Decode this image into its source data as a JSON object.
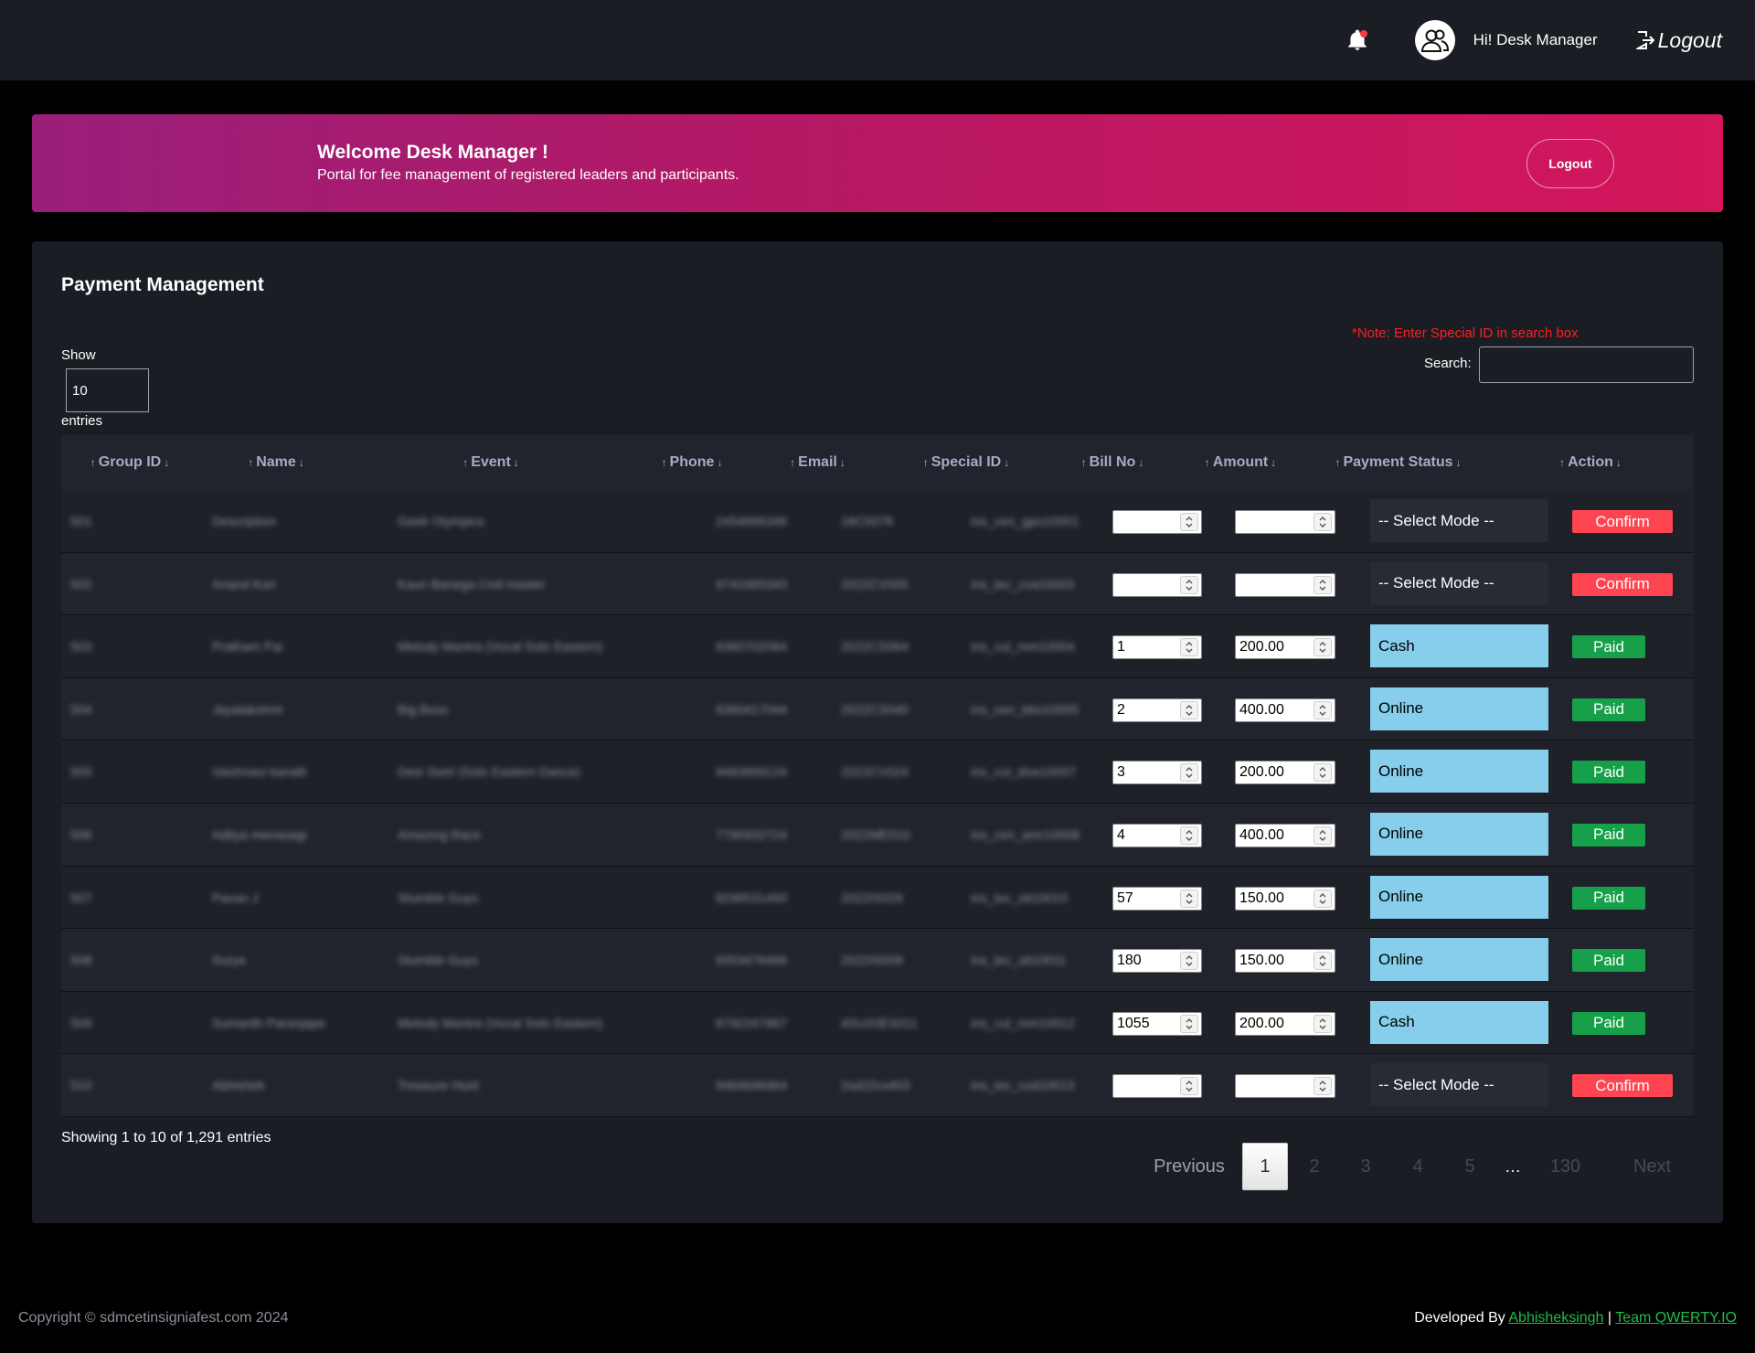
{
  "header": {
    "greeting": "Hi! Desk Manager",
    "logout_label": "Logout",
    "notification_dot_color": "#ff3b3b"
  },
  "banner": {
    "title": "Welcome Desk Manager !",
    "subtitle": "Portal for fee management of registered leaders and participants.",
    "logout_label": "Logout"
  },
  "card": {
    "title": "Payment Management",
    "show_label": "Show",
    "page_size": "10",
    "entries_label": "entries",
    "note": "*Note: Enter Special ID in search box",
    "search_label": "Search:",
    "search_value": ""
  },
  "table": {
    "columns": [
      "Group ID",
      "Name",
      "Event",
      "Phone",
      "Email",
      "Special ID",
      "Bill No",
      "Amount",
      "Payment Status",
      "Action"
    ],
    "rows": [
      {
        "group_id": "501",
        "name": "Description",
        "event": "Geek Olympics",
        "phone": "2454896348",
        "email": "18C5078",
        "special_id": "ins_cen_gpo10001",
        "bill_no": "",
        "amount": "",
        "status": "-- Select Mode --",
        "action": "Confirm"
      },
      {
        "group_id": "502",
        "name": "Anand Kori",
        "event": "Kaun Banega Civil master",
        "phone": "9741665343",
        "email": "2022CV005",
        "special_id": "ins_tec_cva10003",
        "bill_no": "",
        "amount": "",
        "status": "-- Select Mode --",
        "action": "Confirm"
      },
      {
        "group_id": "503",
        "name": "Pratham Pai",
        "event": "Melody Mantra (Vocal Solo Eastern)",
        "phone": "6360702084",
        "email": "2022CS064",
        "special_id": "ins_cul_mm10004",
        "bill_no": "1",
        "amount": "200.00",
        "status": "Cash",
        "action": "Paid"
      },
      {
        "group_id": "504",
        "name": "Jayalakshmi",
        "event": "Big Boss",
        "phone": "9380417044",
        "email": "2022CS040",
        "special_id": "ins_cen_bbo10005",
        "bill_no": "2",
        "amount": "400.00",
        "status": "Online",
        "action": "Paid"
      },
      {
        "group_id": "505",
        "name": "Vaishnavi kanalli",
        "event": "Desi Swirl (Solo Eastern Dance)",
        "phone": "9483999124",
        "email": "2022CV024",
        "special_id": "ins_cul_dsw10007",
        "bill_no": "3",
        "amount": "200.00",
        "status": "Online",
        "action": "Paid"
      },
      {
        "group_id": "506",
        "name": "Aditya menasagi",
        "event": "Amazing Race",
        "phone": "7795932724",
        "email": "2022ME010",
        "special_id": "ins_cen_amr10008",
        "bill_no": "4",
        "amount": "400.00",
        "status": "Online",
        "action": "Paid"
      },
      {
        "group_id": "507",
        "name": "Pavan J",
        "event": "Stumble Guys",
        "phone": "8296531493",
        "email": "2022IS029",
        "special_id": "ins_tec_stt10010",
        "bill_no": "57",
        "amount": "150.00",
        "status": "Online",
        "action": "Paid"
      },
      {
        "group_id": "508",
        "name": "Surya",
        "event": "Stumble Guys",
        "phone": "9353476499",
        "email": "2022IS058",
        "special_id": "ins_tec_stt10011",
        "bill_no": "180",
        "amount": "150.00",
        "status": "Online",
        "action": "Paid"
      },
      {
        "group_id": "509",
        "name": "Sumanth Paranjape",
        "event": "Melody Mantra (Vocal Solo Eastern)",
        "phone": "8792247967",
        "email": "4SU20ES011",
        "special_id": "ins_cul_mm10012",
        "bill_no": "1055",
        "amount": "200.00",
        "status": "Cash",
        "action": "Paid"
      },
      {
        "group_id": "510",
        "name": "Abhishek",
        "event": "Treasure Hunt",
        "phone": "9464646464",
        "email": "2sd22cs403",
        "special_id": "ins_tec_cod10013",
        "bill_no": "",
        "amount": "",
        "status": "-- Select Mode --",
        "action": "Confirm"
      }
    ]
  },
  "pagination": {
    "info": "Showing 1 to 10 of 1,291 entries",
    "previous": "Previous",
    "pages": [
      "1",
      "2",
      "3",
      "4",
      "5"
    ],
    "ellipsis": "…",
    "last": "130",
    "next": "Next"
  },
  "footer": {
    "copyright": "Copyright © sdmcetinsigniafest.com 2024",
    "developed_by": "Developed By",
    "author": "Abhisheksingh",
    "separator": "|",
    "team": "Team QWERTY.IO"
  },
  "colors": {
    "confirm": "#ff4451",
    "paid": "#16a049",
    "mode_set": "#86ceeb",
    "link": "#1fbf4a"
  }
}
